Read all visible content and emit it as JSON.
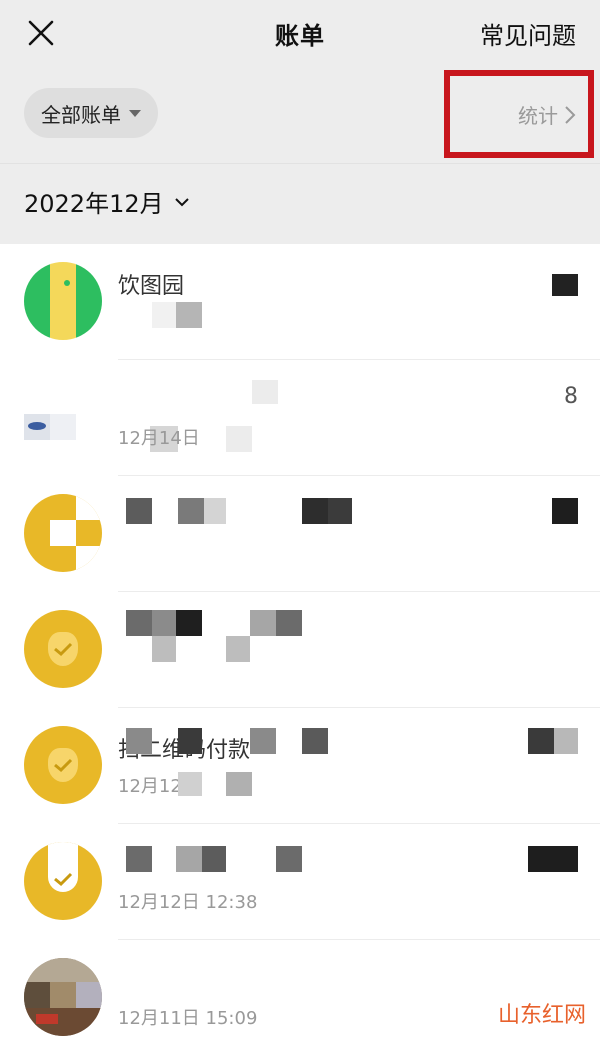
{
  "header": {
    "title": "账单",
    "faq_label": "常见问题"
  },
  "filter": {
    "label": "全部账单",
    "stats_label": "统计"
  },
  "month": {
    "label": "2022年12月"
  },
  "transactions": [
    {
      "title": "饮图园",
      "time": "",
      "amount": ""
    },
    {
      "title": "",
      "time": "12月14日",
      "amount": "8"
    },
    {
      "title": "",
      "time": "",
      "amount": ""
    },
    {
      "title": "",
      "time": "",
      "amount": ""
    },
    {
      "title": "扫二维码付款",
      "time": "12月12日",
      "amount": ""
    },
    {
      "title": "",
      "time": "12月12日 12:38",
      "amount": ""
    },
    {
      "title": "",
      "time": "12月11日 15:09",
      "amount": ""
    }
  ],
  "watermark": "山东红网",
  "colors": {
    "background_top": "#ededed",
    "highlight": "#c8161d",
    "wechat_yellow": "#e8b828",
    "green": "#2dbe60",
    "watermark": "#e8612c"
  }
}
